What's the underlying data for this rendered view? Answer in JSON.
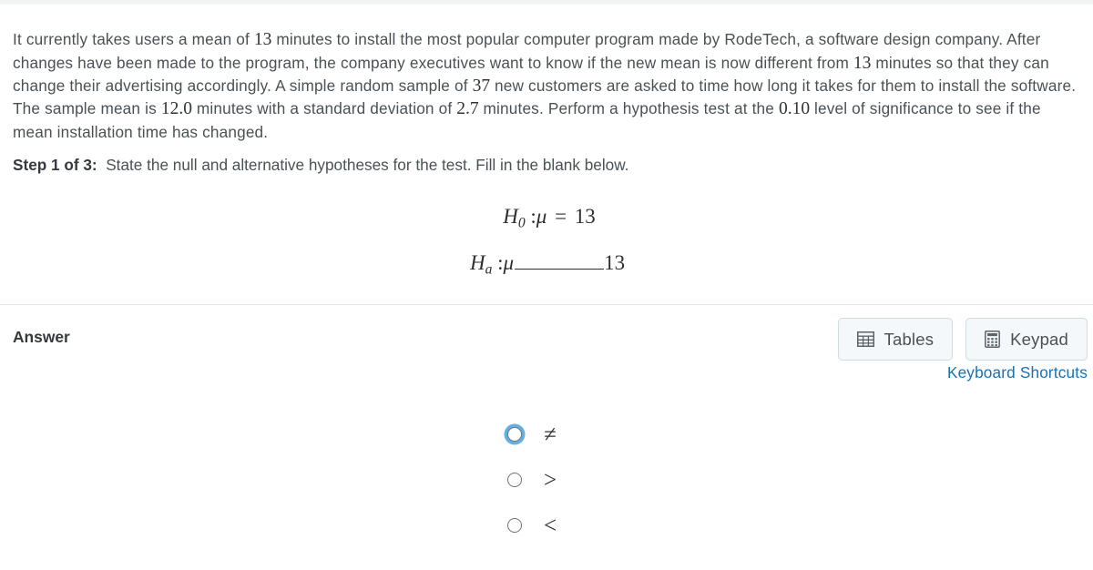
{
  "problem": {
    "segments": [
      {
        "t": "It currently takes users a mean of ",
        "k": "text"
      },
      {
        "t": "13",
        "k": "num"
      },
      {
        "t": " minutes to install the most popular computer program made by RodeTech, a software design company. After changes have been made to the program, the company executives want to know if the new mean is now different from ",
        "k": "text"
      },
      {
        "t": "13",
        "k": "num"
      },
      {
        "t": " minutes so that they can change their advertising accordingly. A simple random sample of ",
        "k": "text"
      },
      {
        "t": "37",
        "k": "num"
      },
      {
        "t": " new customers are asked to time how long it takes for them to install the software. The sample mean is ",
        "k": "text"
      },
      {
        "t": "12.0",
        "k": "num"
      },
      {
        "t": " minutes with a standard deviation of ",
        "k": "text"
      },
      {
        "t": "2.7",
        "k": "num"
      },
      {
        "t": " minutes. Perform a hypothesis test at the ",
        "k": "text"
      },
      {
        "t": "0.10",
        "k": "num"
      },
      {
        "t": " level of significance to see if the mean installation time has changed.",
        "k": "text"
      }
    ]
  },
  "step": {
    "label": "Step 1 of 3",
    "colon": ":",
    "instruction": "State the null and alternative hypotheses for the test. Fill in the blank below."
  },
  "hypotheses": {
    "null": {
      "symbol": "H",
      "subscript": "0",
      "colon": ":",
      "parameter": "μ",
      "operator": "=",
      "value": "13"
    },
    "alternative": {
      "symbol": "H",
      "subscript": "a",
      "colon": ":",
      "parameter": "μ",
      "operator": "",
      "value": "13"
    }
  },
  "answer": {
    "label": "Answer"
  },
  "toolbar": {
    "tables_label": "Tables",
    "tables_icon": "table-grid-icon",
    "keypad_label": "Keypad",
    "keypad_icon": "calculator-icon",
    "keyboard_shortcuts_label": "Keyboard Shortcuts",
    "link_color": "#1672b6",
    "button_bg": "#f4f8fa",
    "button_border": "#cfdce4"
  },
  "options": {
    "focus_ring_color": "#48a0de",
    "items": [
      {
        "symbol": "≠",
        "name": "not-equal",
        "selected": false,
        "focused": true
      },
      {
        "symbol": ">",
        "name": "greater-than",
        "selected": false,
        "focused": false
      },
      {
        "symbol": "<",
        "name": "less-than",
        "selected": false,
        "focused": false
      }
    ]
  }
}
